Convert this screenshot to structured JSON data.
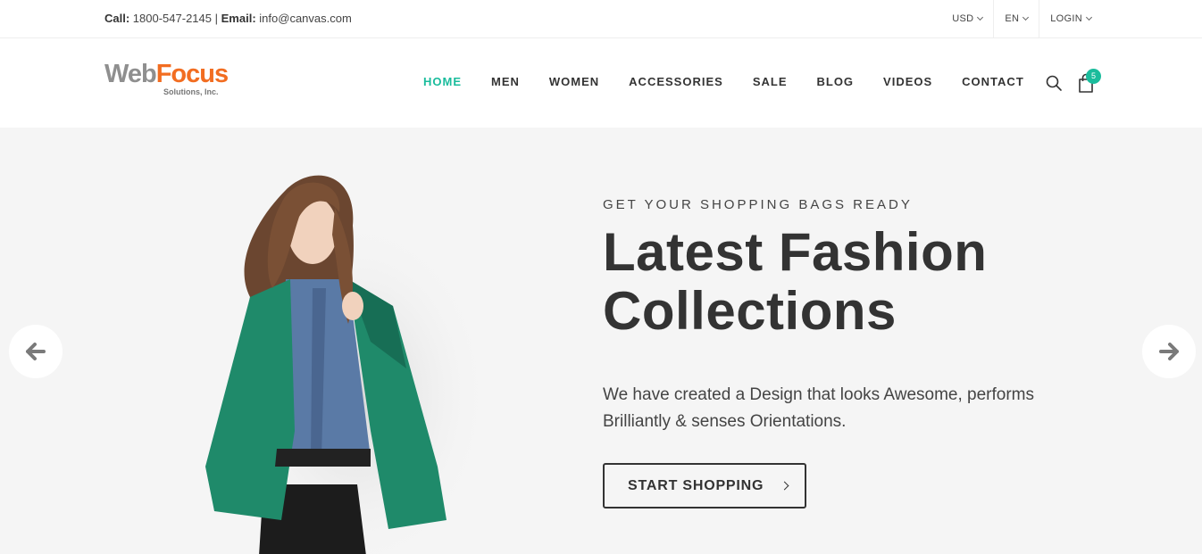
{
  "topbar": {
    "call_label": "Call:",
    "call_value": "1800-547-2145",
    "separator": "|",
    "email_label": "Email:",
    "email_value": "info@canvas.com",
    "currency": "USD",
    "language": "EN",
    "login": "LOGIN"
  },
  "header": {
    "logo_main_1": "Web",
    "logo_main_2": "Focus",
    "logo_sub": "Solutions, Inc.",
    "nav": [
      "HOME",
      "MEN",
      "WOMEN",
      "ACCESSORIES",
      "SALE",
      "BLOG",
      "VIDEOS",
      "CONTACT"
    ],
    "active_nav": "HOME",
    "cart_count": "5",
    "accent_color": "#1abc9c"
  },
  "hero": {
    "eyebrow": "GET YOUR SHOPPING BAGS READY",
    "headline": "Latest Fashion Collections",
    "description": "We have created a Design that looks Awesome, performs Brilliantly & senses Orientations.",
    "cta_label": "START SHOPPING",
    "background": "#f5f5f5",
    "prev_icon": "arrow-left-icon",
    "next_icon": "arrow-right-icon"
  }
}
